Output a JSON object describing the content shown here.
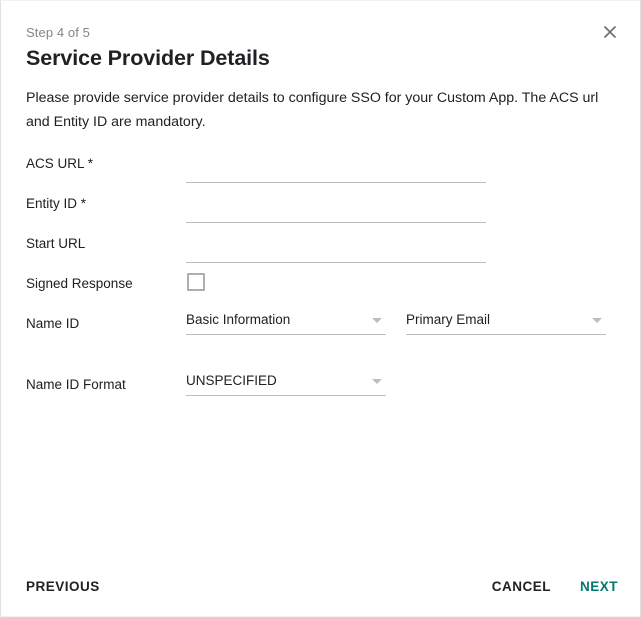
{
  "dialog": {
    "step_label": "Step 4 of 5",
    "title": "Service Provider Details",
    "description": "Please provide service provider details to configure SSO for your Custom App. The ACS url and Entity ID are mandatory.",
    "close_icon": "close-icon"
  },
  "form": {
    "fields": [
      {
        "label": "ACS URL *",
        "type": "text",
        "value": "",
        "placeholder": ""
      },
      {
        "label": "Entity ID *",
        "type": "text",
        "value": "",
        "placeholder": ""
      },
      {
        "label": "Start URL",
        "type": "text",
        "value": "",
        "placeholder": ""
      },
      {
        "label": "Signed Response",
        "type": "checkbox",
        "checked": false
      },
      {
        "label": "Name ID",
        "type": "dual-select",
        "value_primary": "Basic Information",
        "value_secondary": "Primary Email"
      },
      {
        "label": "Name ID Format",
        "type": "select",
        "value": "UNSPECIFIED"
      }
    ]
  },
  "footer": {
    "previous_label": "PREVIOUS",
    "cancel_label": "CANCEL",
    "next_label": "NEXT"
  },
  "colors": {
    "accent": "#00796b",
    "text_primary": "#202124",
    "text_muted": "#80868b",
    "line": "#bdbdbd"
  }
}
